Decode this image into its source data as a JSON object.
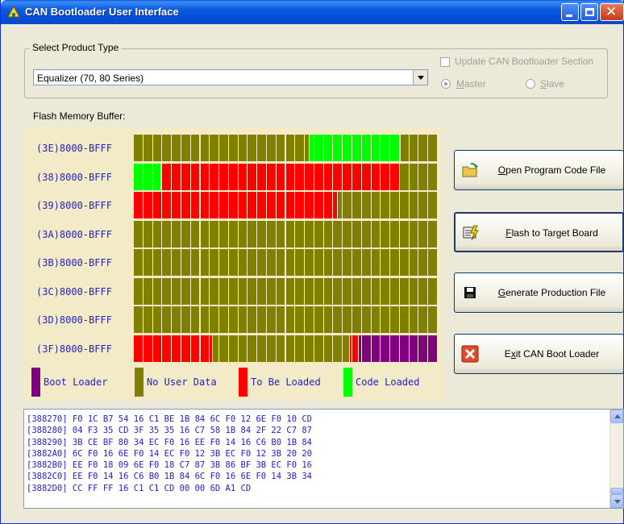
{
  "window": {
    "title": "CAN Bootloader User Interface"
  },
  "product": {
    "group_label": "Select Product Type",
    "selected": "Equalizer (70, 80 Series)"
  },
  "options": {
    "update_section_label": "Update CAN Bootloader Section",
    "update_section_checked": false,
    "master_label": "Master",
    "slave_label": "Slave",
    "selected_role": "Master",
    "enabled": false
  },
  "memory": {
    "label": "Flash Memory Buffer:",
    "cells_per_row": 16,
    "colors": {
      "boot": "#800080",
      "none": "#808000",
      "load": "#ff0000",
      "code": "#00ff00"
    },
    "rows": [
      {
        "label": "(3E)8000-BFFF",
        "cells": [
          "none",
          "none",
          "none",
          "none",
          "none",
          "none",
          "none",
          "none",
          "none",
          "none",
          "none",
          "none",
          "none",
          "none",
          "none",
          "none",
          "none",
          "none",
          "none",
          "none",
          "none",
          "none",
          "none",
          "none",
          "none",
          "none",
          "none",
          "none",
          "none",
          "none",
          "none",
          "none",
          "none",
          "none",
          "none",
          "none",
          "none",
          "none",
          "none",
          "none",
          "none",
          "none",
          "none",
          "none",
          "none",
          "none",
          "none",
          "none",
          "none",
          "none",
          "none",
          "none",
          "none",
          "none",
          "none",
          "none",
          "none",
          "none",
          "none",
          "none",
          "none",
          "none",
          "none",
          "none",
          "none",
          "none",
          "none",
          "none",
          "none",
          "none",
          "none",
          "code",
          "code",
          "code",
          "code",
          "code",
          "code",
          "code",
          "code",
          "code",
          "code",
          "code",
          "code",
          "code",
          "code",
          "code",
          "code",
          "code",
          "code",
          "code",
          "code",
          "code",
          "code",
          "code",
          "code",
          "code",
          "code",
          "code",
          "code",
          "code",
          "code",
          "code",
          "code",
          "code",
          "code",
          "code",
          "code",
          "code",
          "none",
          "none",
          "none",
          "none",
          "none",
          "none",
          "none",
          "none",
          "none",
          "none",
          "none",
          "none",
          "none",
          "none",
          "none"
        ]
      },
      {
        "label": "(38)8000-BFFF",
        "cells": [
          "code",
          "code",
          "code",
          "code",
          "code",
          "code",
          "code",
          "code",
          "code",
          "code",
          "code",
          "load",
          "load",
          "load",
          "load",
          "load",
          "load",
          "load",
          "load",
          "load",
          "load",
          "load",
          "load",
          "load",
          "load",
          "load",
          "load",
          "load",
          "load",
          "load",
          "load",
          "load",
          "load",
          "load",
          "load",
          "load",
          "load",
          "load",
          "load",
          "load",
          "load",
          "load",
          "load",
          "load",
          "load",
          "load",
          "load",
          "load",
          "load",
          "load",
          "load",
          "load",
          "load",
          "load",
          "load",
          "load",
          "load",
          "load",
          "load",
          "load",
          "load",
          "load",
          "load",
          "load",
          "load",
          "load",
          "load",
          "load",
          "load",
          "load",
          "load",
          "load",
          "load",
          "load",
          "load",
          "load",
          "load",
          "load",
          "load",
          "load",
          "load",
          "load",
          "load",
          "load",
          "load",
          "load",
          "load",
          "load",
          "load",
          "load",
          "load",
          "load",
          "load",
          "load",
          "load",
          "load",
          "load",
          "load",
          "load",
          "load",
          "load",
          "load",
          "load",
          "load",
          "load",
          "load",
          "none",
          "none",
          "none",
          "none",
          "none",
          "none",
          "none",
          "none",
          "none",
          "none",
          "none",
          "none",
          "none",
          "none",
          "none"
        ]
      },
      {
        "label": "(39)8000-BFFF",
        "cells": [
          "load",
          "load",
          "load",
          "load",
          "load",
          "load",
          "load",
          "load",
          "load",
          "load",
          "load",
          "load",
          "load",
          "load",
          "load",
          "load",
          "load",
          "load",
          "load",
          "load",
          "load",
          "load",
          "load",
          "load",
          "load",
          "load",
          "load",
          "load",
          "load",
          "load",
          "load",
          "load",
          "load",
          "load",
          "load",
          "load",
          "load",
          "load",
          "load",
          "load",
          "load",
          "load",
          "load",
          "load",
          "load",
          "load",
          "load",
          "load",
          "load",
          "load",
          "load",
          "load",
          "load",
          "load",
          "load",
          "load",
          "load",
          "load",
          "load",
          "load",
          "load",
          "load",
          "load",
          "load",
          "load",
          "load",
          "load",
          "load",
          "load",
          "load",
          "load",
          "load",
          "load",
          "load",
          "load",
          "load",
          "load",
          "load",
          "load",
          "load",
          "load",
          "load",
          "load",
          "load",
          "load",
          "load",
          "none",
          "none",
          "none",
          "none",
          "none",
          "none",
          "none",
          "none",
          "none",
          "none",
          "none",
          "none",
          "none",
          "none",
          "none",
          "none",
          "none",
          "none",
          "none",
          "none",
          "none",
          "none",
          "none",
          "none",
          "none",
          "none",
          "none",
          "none",
          "none",
          "none",
          "none",
          "none",
          "none",
          "none",
          "none",
          "none",
          "none",
          "none",
          "none",
          "none",
          "none",
          "none"
        ]
      },
      {
        "label": "(3A)8000-BFFF",
        "cells": [
          "all-none"
        ]
      },
      {
        "label": "(3B)8000-BFFF",
        "cells": [
          "all-none"
        ]
      },
      {
        "label": "(3C)8000-BFFF",
        "cells": [
          "all-none"
        ]
      },
      {
        "label": "(3D)8000-BFFF",
        "cells": [
          "all-none"
        ]
      },
      {
        "label": "(3F)8000-BFFF",
        "cells": [
          "load",
          "load",
          "load",
          "load",
          "load",
          "load",
          "load",
          "load",
          "load",
          "load",
          "load",
          "load",
          "load",
          "load",
          "load",
          "load",
          "load",
          "load",
          "load",
          "load",
          "load",
          "load",
          "load",
          "load",
          "load",
          "load",
          "load",
          "load",
          "load",
          "load",
          "load",
          "load",
          "load",
          "load",
          "load",
          "load",
          "load",
          "load",
          "load",
          "load",
          "load",
          "load",
          "load",
          "load",
          "none",
          "none",
          "none",
          "none",
          "none",
          "none",
          "none",
          "none",
          "none",
          "none",
          "none",
          "none",
          "none",
          "none",
          "none",
          "none",
          "none",
          "none",
          "none",
          "none",
          "none",
          "none",
          "none",
          "none",
          "none",
          "none",
          "none",
          "none",
          "none",
          "none",
          "none",
          "none",
          "none",
          "none",
          "none",
          "none",
          "none",
          "none",
          "none",
          "none",
          "none",
          "none",
          "none",
          "none",
          "none",
          "none",
          "none",
          "none",
          "none",
          "none",
          "none",
          "none",
          "none",
          "none",
          "none",
          "none",
          "none",
          "none",
          "none",
          "none",
          "none",
          "none",
          "none",
          "none",
          "none",
          "none",
          "none",
          "none",
          "none",
          "none",
          "none",
          "none",
          "none",
          "none",
          "none",
          "none",
          "load",
          "load",
          "load",
          "load",
          "load",
          "boot",
          "boot",
          "boot",
          "boot",
          "boot",
          "boot",
          "boot",
          "boot",
          "boot",
          "boot",
          "boot",
          "boot",
          "boot",
          "boot",
          "boot",
          "boot",
          "boot",
          "boot",
          "boot",
          "boot",
          "boot",
          "boot",
          "boot",
          "boot",
          "boot",
          "boot",
          "boot",
          "boot",
          "boot",
          "boot",
          "boot",
          "boot",
          "boot",
          "boot",
          "boot",
          "boot",
          "boot",
          "boot",
          "boot",
          "boot",
          "boot",
          "boot",
          "boot",
          "boot"
        ]
      }
    ],
    "legend": [
      {
        "key": "boot",
        "label": "Boot Loader"
      },
      {
        "key": "none",
        "label": "No User Data"
      },
      {
        "key": "load",
        "label": "To Be Loaded"
      },
      {
        "key": "code",
        "label": "Code Loaded"
      }
    ]
  },
  "buttons": [
    {
      "id": "open",
      "accel": "O",
      "rest": "pen Program Code File",
      "icon": "folder-icon"
    },
    {
      "id": "flash",
      "accel": "F",
      "rest": "lash to Target Board",
      "icon": "flash-icon"
    },
    {
      "id": "generate",
      "accel": "G",
      "rest": "enerate Production File",
      "icon": "floppy-disk-icon"
    },
    {
      "id": "exit",
      "pre": "E",
      "accel": "x",
      "rest": "it CAN Boot Loader",
      "icon": "close-x-icon"
    }
  ],
  "log": {
    "lines": [
      "[388270] F0 1C B7 54 16 C1 BE 1B 84 6C F0 12 6E F0 10 CD",
      "[388280] 04 F3 35 CD 3F 35 35 16 C7 58 1B 84 2F 22 C7 87",
      "[388290] 3B CE BF 80 34 EC F0 16 EE F0 14 16 C6 B0 1B 84",
      "[3882A0] 6C F0 16 6E F0 14 EC F0 12 3B EC F0 12 3B 20 20",
      "[3882B0] EE F0 18 09 6E F0 18 C7 87 3B 86 BF 3B EC F0 16",
      "[3882C0] EE F0 14 16 C6 B0 1B 84 6C F0 16 6E F0 14 3B 34",
      "[3882D0] CC FF FF 16 C1 C1 CD 00 00 6D A1 CD"
    ]
  }
}
